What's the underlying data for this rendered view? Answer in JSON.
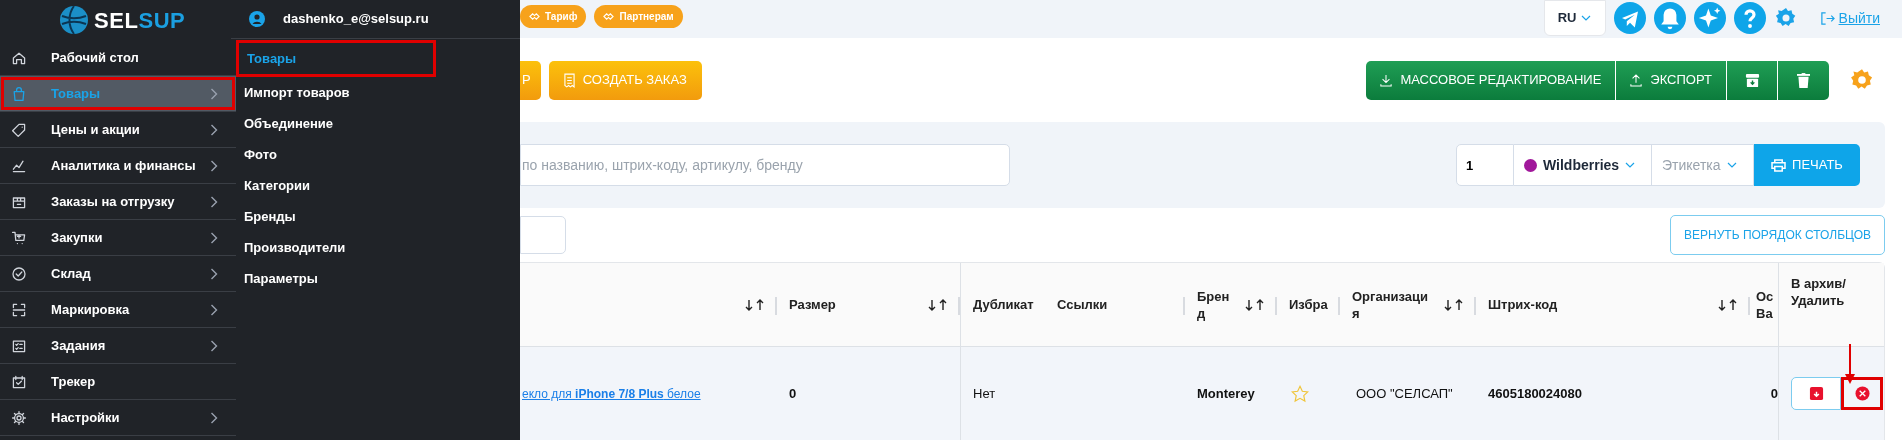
{
  "logo": {
    "text_a": "SEL",
    "text_b": "SUP"
  },
  "sidebar": {
    "items": [
      {
        "label": "Рабочий стол",
        "has_submenu": false,
        "selected": false,
        "highlighted": false
      },
      {
        "label": "Товары",
        "has_submenu": true,
        "selected": true,
        "highlighted": true
      },
      {
        "label": "Цены и акции",
        "has_submenu": true,
        "selected": false,
        "highlighted": false
      },
      {
        "label": "Аналитика и финансы",
        "has_submenu": true,
        "selected": false,
        "highlighted": false
      },
      {
        "label": "Заказы на отгрузку",
        "has_submenu": true,
        "selected": false,
        "highlighted": false
      },
      {
        "label": "Закупки",
        "has_submenu": true,
        "selected": false,
        "highlighted": false
      },
      {
        "label": "Склад",
        "has_submenu": true,
        "selected": false,
        "highlighted": false
      },
      {
        "label": "Маркировка",
        "has_submenu": true,
        "selected": false,
        "highlighted": false
      },
      {
        "label": "Задания",
        "has_submenu": true,
        "selected": false,
        "highlighted": false
      },
      {
        "label": "Трекер",
        "has_submenu": false,
        "selected": false,
        "highlighted": false
      },
      {
        "label": "Настройки",
        "has_submenu": true,
        "selected": false,
        "highlighted": false
      }
    ]
  },
  "submenu": {
    "user": "dashenko_e@selsup.ru",
    "items": [
      {
        "label": "Товары",
        "selected": true,
        "highlighted": true
      },
      {
        "label": "Импорт товаров",
        "selected": false,
        "highlighted": false
      },
      {
        "label": "Объединение",
        "selected": false,
        "highlighted": false
      },
      {
        "label": "Фото",
        "selected": false,
        "highlighted": false
      },
      {
        "label": "Категории",
        "selected": false,
        "highlighted": false
      },
      {
        "label": "Бренды",
        "selected": false,
        "highlighted": false
      },
      {
        "label": "Производители",
        "selected": false,
        "highlighted": false
      },
      {
        "label": "Параметры",
        "selected": false,
        "highlighted": false
      }
    ]
  },
  "top_bar": {
    "badges": [
      "Тариф",
      "Партнерам"
    ],
    "language": "RU",
    "logout": "Выйти"
  },
  "toolbar": {
    "order_buttons": [
      "Р",
      "СОЗДАТЬ ЗАКАЗ"
    ],
    "bulk_edit": "МАССОВОЕ РЕДАКТИРОВАНИЕ",
    "export": "ЭКСПОРТ"
  },
  "filters": {
    "search_placeholder": "по названию, штрих-коду, артикулу, бренду",
    "quantity": "1",
    "marketplace": "Wildberries",
    "label_placeholder": "Этикетка",
    "print": "ПЕЧАТЬ"
  },
  "reset_columns": "ВЕРНУТЬ ПОРЯДОК СТОЛБЦОВ",
  "table": {
    "columns": [
      {
        "sortable": true
      },
      {
        "label": "Размер",
        "sortable": true
      },
      {
        "label": "Дубликат",
        "sortable": false
      },
      {
        "label": "Ссылки",
        "sortable": false
      },
      {
        "label": "Бренд",
        "sortable": true
      },
      {
        "label": "Избра",
        "sortable": false
      },
      {
        "label": "Организация",
        "sortable": true
      },
      {
        "label": "Штрих-код",
        "sortable": true
      },
      {
        "label": "Ос Ва",
        "sortable": false
      },
      {
        "label": "В архив/ Удалить",
        "sortable": false
      }
    ],
    "rows": [
      {
        "product": "екло для **iPhone 7/8 Plus** белое",
        "size": "0",
        "duplicate": "Нет",
        "brand": "Monterey",
        "favorite": false,
        "organization": "ООО \"СЕЛСАП\"",
        "barcode": "4605180024080",
        "column_9": "0",
        "delete_highlighted": true
      }
    ]
  }
}
